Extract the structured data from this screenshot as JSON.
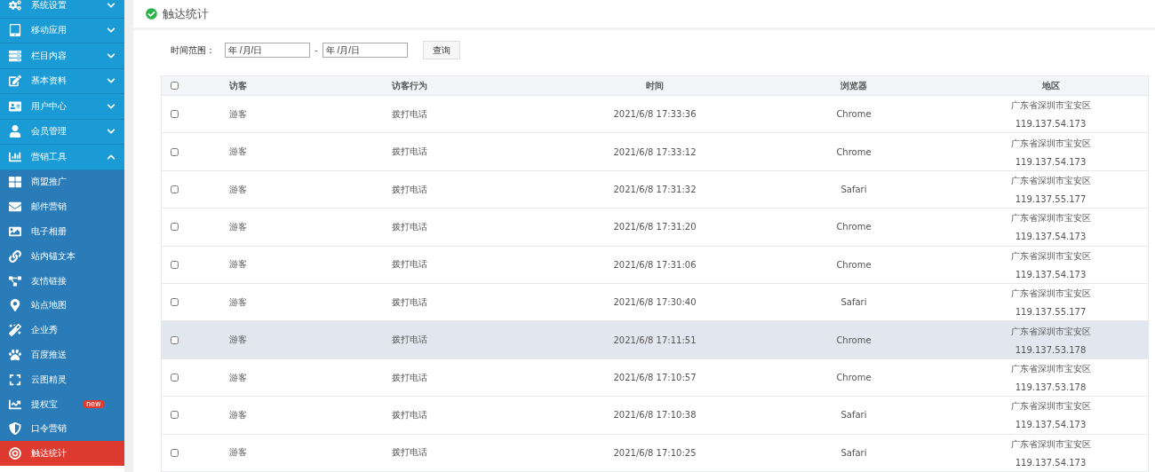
{
  "sidebar": {
    "items": [
      {
        "kind": "group",
        "label": "系统设置",
        "expanded": false
      },
      {
        "kind": "group",
        "label": "移动应用",
        "expanded": false
      },
      {
        "kind": "group",
        "label": "栏目内容",
        "expanded": false
      },
      {
        "kind": "group",
        "label": "基本资料",
        "expanded": false
      },
      {
        "kind": "group",
        "label": "用户中心",
        "expanded": false
      },
      {
        "kind": "group",
        "label": "会员管理",
        "expanded": false
      },
      {
        "kind": "group",
        "label": "营销工具",
        "expanded": true
      },
      {
        "kind": "sub",
        "label": "商盟推广",
        "selected": false
      },
      {
        "kind": "sub",
        "label": "邮件营销",
        "selected": false
      },
      {
        "kind": "sub",
        "label": "电子相册",
        "selected": false
      },
      {
        "kind": "sub",
        "label": "站内锚文本",
        "selected": false
      },
      {
        "kind": "sub",
        "label": "友情链接",
        "selected": false
      },
      {
        "kind": "sub",
        "label": "站点地图",
        "selected": false
      },
      {
        "kind": "sub",
        "label": "企业秀",
        "selected": false
      },
      {
        "kind": "sub",
        "label": "百度推送",
        "selected": false
      },
      {
        "kind": "sub",
        "label": "云图精灵",
        "selected": false
      },
      {
        "kind": "sub",
        "label": "提权宝",
        "selected": false,
        "badge": "new"
      },
      {
        "kind": "sub",
        "label": "口令营销",
        "selected": false
      },
      {
        "kind": "sub",
        "label": "触达统计",
        "selected": true
      }
    ]
  },
  "page": {
    "title": "触达统计"
  },
  "filter": {
    "label": "时间范围：",
    "start": {
      "value": "年 /月/日"
    },
    "separator": "-",
    "end": {
      "value": "年 /月/日"
    },
    "button": "查询"
  },
  "table": {
    "select_all": {
      "checked": false
    },
    "columns": [
      "访客",
      "访客行为",
      "时间",
      "浏览器",
      "地区"
    ],
    "rows": [
      {
        "checked": false,
        "highlighted": false,
        "visitor": "游客",
        "action": "拨打电话",
        "time": "2021/6/8 17:33:36",
        "browser": "Chrome",
        "region": "广东省深圳市宝安区",
        "ip": "119.137.54.173"
      },
      {
        "checked": false,
        "highlighted": false,
        "visitor": "游客",
        "action": "拨打电话",
        "time": "2021/6/8 17:33:12",
        "browser": "Chrome",
        "region": "广东省深圳市宝安区",
        "ip": "119.137.54.173"
      },
      {
        "checked": false,
        "highlighted": false,
        "visitor": "游客",
        "action": "拨打电话",
        "time": "2021/6/8 17:31:32",
        "browser": "Safari",
        "region": "广东省深圳市宝安区",
        "ip": "119.137.55.177"
      },
      {
        "checked": false,
        "highlighted": false,
        "visitor": "游客",
        "action": "拨打电话",
        "time": "2021/6/8 17:31:20",
        "browser": "Chrome",
        "region": "广东省深圳市宝安区",
        "ip": "119.137.54.173"
      },
      {
        "checked": false,
        "highlighted": false,
        "visitor": "游客",
        "action": "拨打电话",
        "time": "2021/6/8 17:31:06",
        "browser": "Chrome",
        "region": "广东省深圳市宝安区",
        "ip": "119.137.54.173"
      },
      {
        "checked": false,
        "highlighted": false,
        "visitor": "游客",
        "action": "拨打电话",
        "time": "2021/6/8 17:30:40",
        "browser": "Safari",
        "region": "广东省深圳市宝安区",
        "ip": "119.137.55.177"
      },
      {
        "checked": false,
        "highlighted": true,
        "visitor": "游客",
        "action": "拨打电话",
        "time": "2021/6/8 17:11:51",
        "browser": "Chrome",
        "region": "广东省深圳市宝安区",
        "ip": "119.137.53.178"
      },
      {
        "checked": false,
        "highlighted": false,
        "visitor": "游客",
        "action": "拨打电话",
        "time": "2021/6/8 17:10:57",
        "browser": "Chrome",
        "region": "广东省深圳市宝安区",
        "ip": "119.137.53.178"
      },
      {
        "checked": false,
        "highlighted": false,
        "visitor": "游客",
        "action": "拨打电话",
        "time": "2021/6/8 17:10:38",
        "browser": "Safari",
        "region": "广东省深圳市宝安区",
        "ip": "119.137.54.173"
      },
      {
        "checked": false,
        "highlighted": false,
        "visitor": "游客",
        "action": "拨打电话",
        "time": "2021/6/8 17:10:25",
        "browser": "Safari",
        "region": "广东省深圳市宝安区",
        "ip": "119.137.54.173"
      }
    ]
  }
}
